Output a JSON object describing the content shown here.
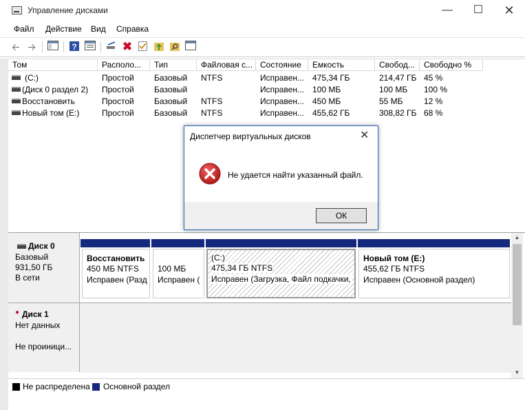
{
  "window": {
    "title": "Управление дисками",
    "minimize_icon": "minimize-icon",
    "maximize_icon": "maximize-icon",
    "close_icon": "close-icon"
  },
  "menu": [
    "Файл",
    "Действие",
    "Вид",
    "Справка"
  ],
  "toolbar_icons": [
    "back-arrow-icon",
    "forward-arrow-icon",
    "console-tree-icon",
    "help-icon",
    "properties-icon",
    "connect-icon",
    "delete-icon",
    "check-icon",
    "up-folder-icon",
    "search-folder-icon",
    "window-icon"
  ],
  "table": {
    "columns": [
      "Том",
      "Располо...",
      "Тип",
      "Файловая с...",
      "Состояние",
      "Емкость",
      "Свобод...",
      "Свободно %"
    ],
    "rows": [
      [
        "(C:)",
        "Простой",
        "Базовый",
        "NTFS",
        "Исправен...",
        "475,34 ГБ",
        "214,47 ГБ",
        "45 %"
      ],
      [
        "(Диск 0 раздел 2)",
        "Простой",
        "Базовый",
        "",
        "Исправен...",
        "100 МБ",
        "100 МБ",
        "100 %"
      ],
      [
        "Восстановить",
        "Простой",
        "Базовый",
        "NTFS",
        "Исправен...",
        "450 МБ",
        "55 МБ",
        "12 %"
      ],
      [
        "Новый том (E:)",
        "Простой",
        "Базовый",
        "NTFS",
        "Исправен...",
        "455,62 ГБ",
        "308,82 ГБ",
        "68 %"
      ]
    ]
  },
  "dialog": {
    "title": "Диспетчер виртуальных дисков",
    "message": "Не удается найти указанный файл.",
    "ok_label": "ОК",
    "error_icon": "error-icon"
  },
  "disks": [
    {
      "name": "Диск 0",
      "type": "Базовый",
      "size": "931,50 ГБ",
      "status": "В сети",
      "partitions": [
        {
          "name": "Восстановить",
          "size": "450 МБ NTFS",
          "status": "Исправен (Разде"
        },
        {
          "name": "",
          "size": "100 МБ",
          "status": "Исправен ("
        },
        {
          "name": "(C:)",
          "size": "475,34 ГБ NTFS",
          "status": "Исправен (Загрузка, Файл подкачки, "
        },
        {
          "name": "Новый том  (E:)",
          "size": "455,62 ГБ NTFS",
          "status": "Исправен (Основной раздел)"
        }
      ]
    },
    {
      "name": "Диск 1",
      "type": "Нет данных",
      "size": "",
      "status": "Не проиници..."
    }
  ],
  "legend": [
    {
      "label": "Не распределена",
      "color": "#000000"
    },
    {
      "label": "Основной раздел",
      "color": "#14287d"
    }
  ],
  "colors": {
    "partition_header": "#14287d",
    "dialog_border": "#2a66b5",
    "error_red": "#d32f2f"
  }
}
